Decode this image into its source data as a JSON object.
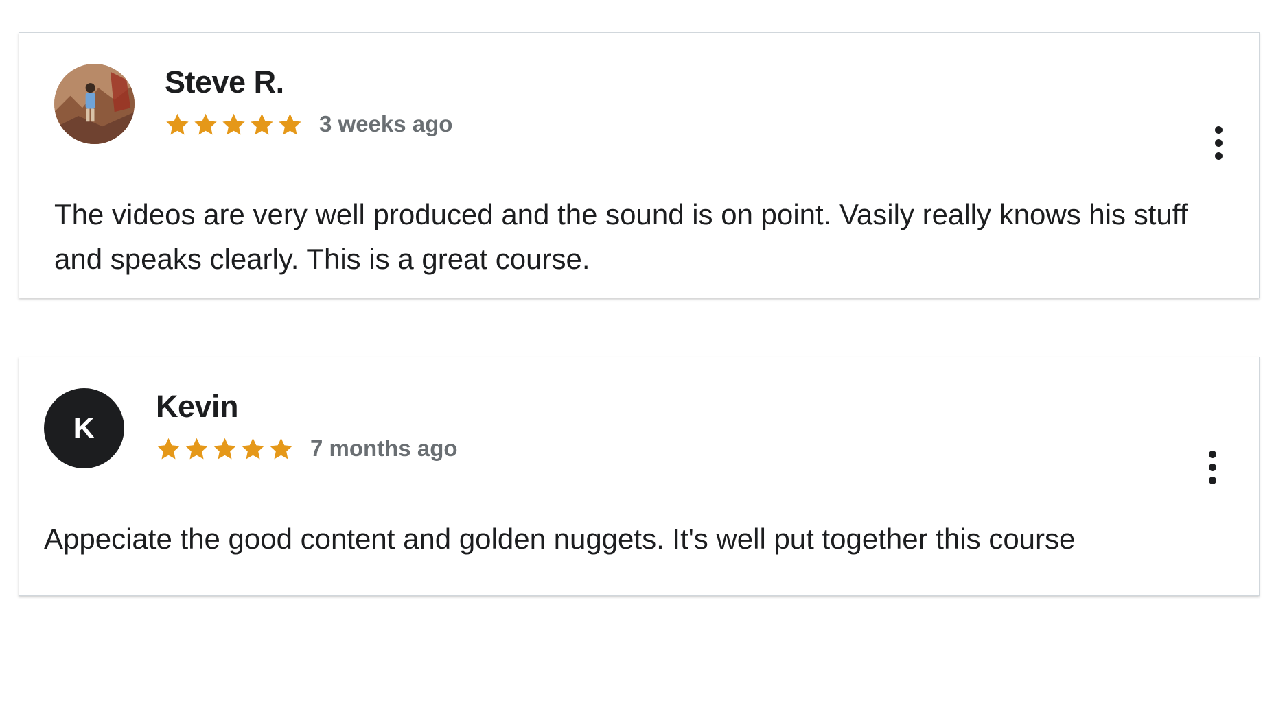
{
  "colors": {
    "star": "#e59819",
    "text": "#1c1d1f",
    "muted": "#6a6f73",
    "border": "#d1d7dc",
    "avatar_bg": "#1c1d1f"
  },
  "reviews": [
    {
      "reviewer": "Steve R.",
      "avatar": {
        "type": "photo",
        "icon": "user-photo"
      },
      "rating": 5,
      "rating_max": 5,
      "time": "3 weeks ago",
      "text": "The videos are very well produced and the sound is on point. Vasily really knows his stuff and speaks clearly. This is a great course.",
      "menu_icon": "more-vertical-icon"
    },
    {
      "reviewer": "Kevin",
      "avatar": {
        "type": "initial",
        "initial": "K"
      },
      "rating": 5,
      "rating_max": 5,
      "time": "7 months ago",
      "text": "Appeciate the good content and golden nuggets. It's well put together this course",
      "menu_icon": "more-vertical-icon"
    }
  ]
}
